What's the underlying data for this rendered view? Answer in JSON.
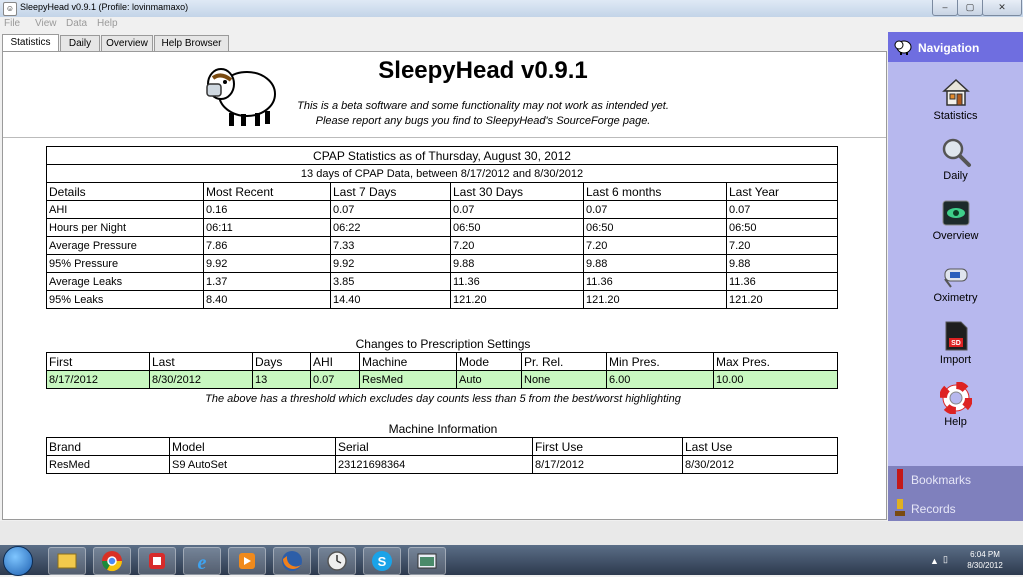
{
  "window": {
    "title": "SleepyHead v0.9.1  (Profile: lovinmamaxo)",
    "controls": {
      "minimize": "–",
      "maximize": "▢",
      "close": "✕"
    }
  },
  "menu": [
    "File",
    "View",
    "Data",
    "Help"
  ],
  "tabs": [
    "Statistics",
    "Daily",
    "Overview",
    "Help Browser"
  ],
  "header": {
    "title": "SleepyHead v0.9.1",
    "beta_line1": "This is a beta software and some functionality may not work as intended yet.",
    "beta_line2": "Please report any bugs you find to SleepyHead's SourceForge page."
  },
  "stats": {
    "caption": "CPAP Statistics as of Thursday, August 30, 2012",
    "subcaption": "13 days of CPAP Data, between 8/17/2012 and 8/30/2012",
    "columns": [
      "Details",
      "Most Recent",
      "Last 7 Days",
      "Last 30 Days",
      "Last 6 months",
      "Last Year"
    ],
    "rows": [
      [
        "AHI",
        "0.16",
        "0.07",
        "0.07",
        "0.07",
        "0.07"
      ],
      [
        "Hours per Night",
        "06:11",
        "06:22",
        "06:50",
        "06:50",
        "06:50"
      ],
      [
        "Average Pressure",
        "7.86",
        "7.33",
        "7.20",
        "7.20",
        "7.20"
      ],
      [
        "95% Pressure",
        "9.92",
        "9.92",
        "9.88",
        "9.88",
        "9.88"
      ],
      [
        "Average Leaks",
        "1.37",
        "3.85",
        "11.36",
        "11.36",
        "11.36"
      ],
      [
        "95% Leaks",
        "8.40",
        "14.40",
        "121.20",
        "121.20",
        "121.20"
      ]
    ]
  },
  "prescription": {
    "title": "Changes to Prescription Settings",
    "columns": [
      "First",
      "Last",
      "Days",
      "AHI",
      "Machine",
      "Mode",
      "Pr. Rel.",
      "Min Pres.",
      "Max Pres."
    ],
    "rows": [
      [
        "8/17/2012",
        "8/30/2012",
        "13",
        "0.07",
        "ResMed",
        "Auto",
        "None",
        "6.00",
        "10.00"
      ]
    ],
    "highlight_color": "#c8f7c0",
    "note": "The above has a threshold which excludes day counts less than 5 from the best/worst highlighting"
  },
  "machine": {
    "title": "Machine Information",
    "columns": [
      "Brand",
      "Model",
      "Serial",
      "First Use",
      "Last Use"
    ],
    "rows": [
      [
        "ResMed",
        "S9 AutoSet",
        "23121698364",
        "8/17/2012",
        "8/30/2012"
      ]
    ]
  },
  "sidebar": {
    "header": "Navigation",
    "items": [
      "Statistics",
      "Daily",
      "Overview",
      "Oximetry",
      "Import",
      "Help"
    ],
    "bottom": [
      "Bookmarks",
      "Records"
    ]
  },
  "taskbar": {
    "time": "6:04 PM",
    "date": "8/30/2012"
  }
}
